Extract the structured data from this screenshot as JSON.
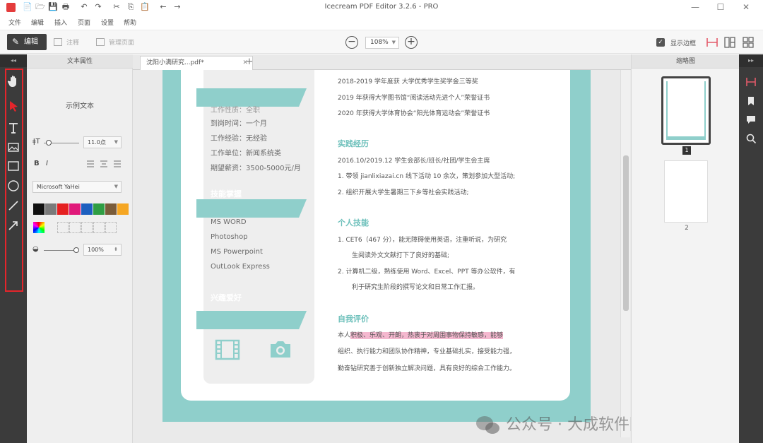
{
  "window": {
    "title": "Icecream PDF Editor 3.2.6 - PRO",
    "minimize": "—",
    "maximize": "☐",
    "close": "✕"
  },
  "quick_access": [
    "📄",
    "🗁",
    "💾",
    "🖶",
    "↶",
    "↷",
    "✂",
    "⎘",
    "📋",
    "←",
    "→"
  ],
  "menu": [
    "文件",
    "编辑",
    "插入",
    "页面",
    "设置",
    "帮助"
  ],
  "toolbar": {
    "edit_mode": "编辑",
    "annotate_mode": "注释",
    "manage_pages_mode": "管理页面",
    "zoom_out": "−",
    "zoom_value": "108%",
    "zoom_in": "+",
    "show_thumbnails_label": "显示边框",
    "show_thumbnails_checked": true
  },
  "left_strip": {
    "collapse": "◂◂",
    "tools": [
      "hand-tool-icon",
      "select-tool-icon",
      "text-tool-icon",
      "image-tool-icon",
      "rectangle-tool-icon",
      "ellipse-tool-icon",
      "line-tool-icon",
      "arrow-tool-icon"
    ]
  },
  "props": {
    "title": "文本属性",
    "sample": "示例文本",
    "font_size": "11.0点",
    "font_family": "Microsoft YaHei",
    "opacity": "100%",
    "bold": "B",
    "italic": "I",
    "colors": [
      "#111111",
      "#7a7a7a",
      "#e52020",
      "#e0197a",
      "#1d5fbf",
      "#2f9e44",
      "#7a5c3a",
      "#f5a623"
    ]
  },
  "tabs": {
    "doc_name": "沈阳小满研究...pdf",
    "modified": "*",
    "close": "✕",
    "add": "+"
  },
  "document": {
    "left_col": {
      "info_rows": [
        "到岗时间：一个月",
        "工作经验：无经验",
        "工作单位：新闻系统类",
        "期望薪资：3500-5000元/月"
      ],
      "top_partial": "工作性质：全职",
      "skills_title": "技能掌握",
      "skills": [
        "MS WORD",
        "Photoshop",
        "MS Powerpoint",
        "OutLook Express"
      ],
      "hobbies_title": "兴趣爱好"
    },
    "awards": [
      "2018-2019 学年度获   大学优秀学生奖学金三等奖",
      "2019 年获得大学图书馆“阅读活动先进个人”荣誉证书",
      "2020 年获得大学体育协会“阳光体育运动会”荣誉证书"
    ],
    "practice_title": "实践经历",
    "practice": [
      "2016.10/2019.12 学生会部长/班长/社团/学生会主席",
      "1. 带领 jianlixiazai.cn 线下活动 10 余次，策划参加大型活动;",
      "2. 组织开展大学生暑期三下乡等社会实践活动;"
    ],
    "skills_title": "个人技能",
    "skills": [
      "1.   CET6（467 分），能无障碍使用英语，注重听说，为研究",
      "生阅读外文文献打下了良好的基础;",
      "2.   计算机二级，熟练使用 Word、Excel、PPT 等办公软件，有",
      "利于研究生阶段的撰写论文和日常工作汇报。"
    ],
    "eval_title": "自我评价",
    "eval_prefix": "本人",
    "eval_highlight": "积极、乐观、开朗，热衷于对周围事物保持敏感，能够",
    "eval_rest": [
      "组织、执行能力和团队协作精神，专业基础扎实，接受能力强，",
      "勤奋钻研究善于创新独立解决问题，具有良好的综合工作能力。"
    ]
  },
  "watermark": "公众号 · 大成软件园",
  "thumbnails": {
    "title": "缩略图",
    "pages": [
      "1",
      "2"
    ]
  }
}
